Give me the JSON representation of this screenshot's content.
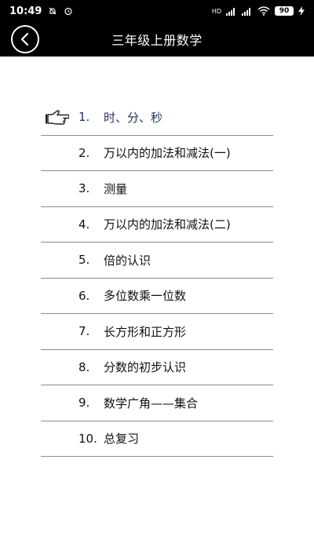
{
  "status_bar": {
    "time": "10:49",
    "network": "HD",
    "battery": "90"
  },
  "header": {
    "title": "三年级上册数学",
    "back_icon": "chevron-left-icon"
  },
  "chapters": [
    {
      "num": "1.",
      "label": "时、分、秒",
      "selected": true
    },
    {
      "num": "2.",
      "label": "万以内的加法和减法(一)"
    },
    {
      "num": "3.",
      "label": "测量"
    },
    {
      "num": "4.",
      "label": "万以内的加法和减法(二)"
    },
    {
      "num": "5.",
      "label": "倍的认识"
    },
    {
      "num": "6.",
      "label": "多位数乘一位数"
    },
    {
      "num": "7.",
      "label": "长方形和正方形"
    },
    {
      "num": "8.",
      "label": "分数的初步认识"
    },
    {
      "num": "9.",
      "label": "数学广角——集合"
    },
    {
      "num": "10.",
      "label": "总复习"
    }
  ],
  "colors": {
    "bar_bg": "#000000",
    "divider": "#8c8c8c",
    "selected_text": "#23325f"
  }
}
